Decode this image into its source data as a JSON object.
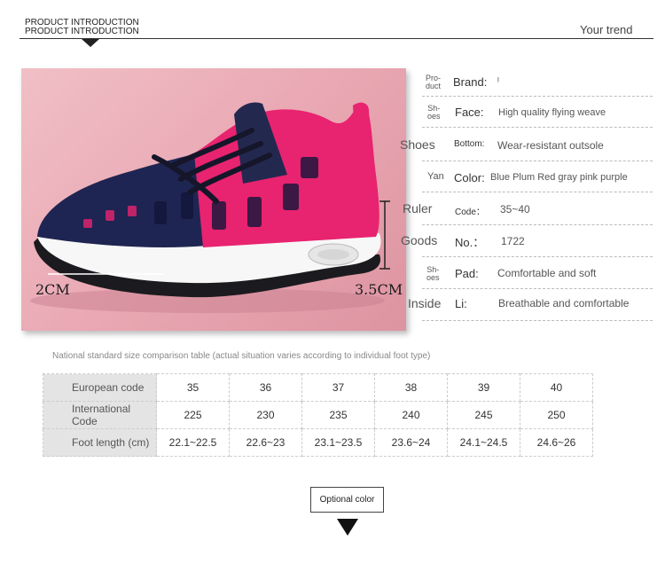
{
  "header": {
    "title_line1": "PRODUCT INTRODUCTION",
    "title_line2": "PRODUCT INTRODUCTION",
    "trend": "Your trend"
  },
  "photo": {
    "left_measure": "2CM",
    "right_measure": "3.5CM"
  },
  "side_words": {
    "product": "Pro-\nduct",
    "shoes_small_1": "Sh-\noes",
    "shoes": "Shoes",
    "yan": "Yan",
    "ruler": "Ruler",
    "goods": "Goods",
    "shoes_small_2": "Sh-\noes",
    "inside": "Inside"
  },
  "specs": [
    {
      "key": "Brand:",
      "value": "ᴵ"
    },
    {
      "key": "Face:",
      "value": "High quality flying weave"
    },
    {
      "key": "Bottom:",
      "value": "Wear-resistant outsole"
    },
    {
      "key": "Color:",
      "value": "Blue Plum Red gray pink purple"
    },
    {
      "key": "Code：",
      "value": "35~40"
    },
    {
      "key": "No.：",
      "value": "1722"
    },
    {
      "key": "Pad:",
      "value": "Comfortable and soft"
    },
    {
      "key": "Li:",
      "value": "Breathable and comfortable"
    }
  ],
  "size_table": {
    "caption": "National standard size comparison table (actual situation varies according to individual foot type)",
    "rows": [
      {
        "label": "European code",
        "cells": [
          "35",
          "36",
          "37",
          "38",
          "39",
          "40"
        ]
      },
      {
        "label": "International Code",
        "cells": [
          "225",
          "230",
          "235",
          "240",
          "245",
          "250"
        ]
      },
      {
        "label": "Foot length (cm)",
        "cells": [
          "22.1~22.5",
          "22.6~23",
          "23.1~23.5",
          "23.6~24",
          "24.1~24.5",
          "24.6~26"
        ]
      }
    ]
  },
  "optional_color": "Optional color"
}
